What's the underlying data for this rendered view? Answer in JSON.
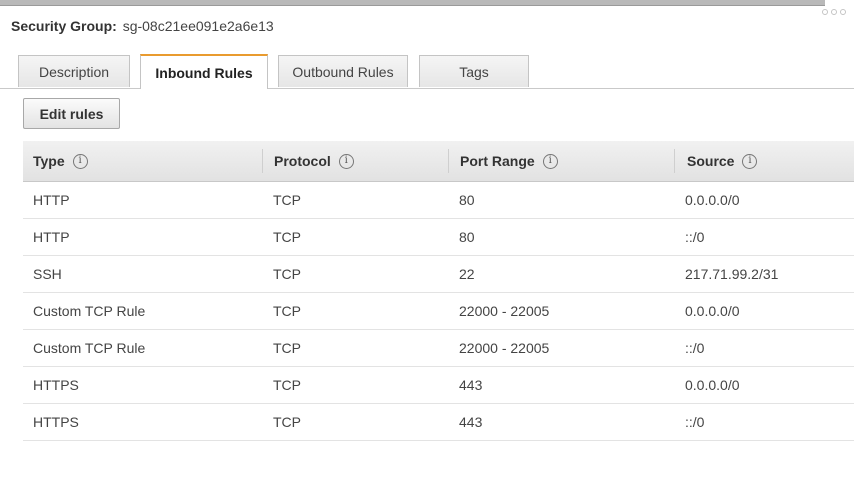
{
  "header": {
    "label": "Security Group:",
    "value": "sg-08c21ee091e2a6e13"
  },
  "tabs": [
    {
      "label": "Description",
      "active": false
    },
    {
      "label": "Inbound Rules",
      "active": true
    },
    {
      "label": "Outbound Rules",
      "active": false
    },
    {
      "label": "Tags",
      "active": false
    }
  ],
  "toolbar": {
    "edit_label": "Edit rules"
  },
  "table": {
    "columns": [
      "Type",
      "Protocol",
      "Port Range",
      "Source"
    ],
    "info_glyph": "i",
    "rows": [
      {
        "type": "HTTP",
        "protocol": "TCP",
        "port": "80",
        "source": "0.0.0.0/0"
      },
      {
        "type": "HTTP",
        "protocol": "TCP",
        "port": "80",
        "source": "::/0"
      },
      {
        "type": "SSH",
        "protocol": "TCP",
        "port": "22",
        "source": "217.71.99.2/31"
      },
      {
        "type": "Custom TCP Rule",
        "protocol": "TCP",
        "port": "22000 - 22005",
        "source": "0.0.0.0/0"
      },
      {
        "type": "Custom TCP Rule",
        "protocol": "TCP",
        "port": "22000 - 22005",
        "source": "::/0"
      },
      {
        "type": "HTTPS",
        "protocol": "TCP",
        "port": "443",
        "source": "0.0.0.0/0"
      },
      {
        "type": "HTTPS",
        "protocol": "TCP",
        "port": "443",
        "source": "::/0"
      }
    ]
  },
  "colors": {
    "active_tab_accent": "#e99b2f",
    "header_bg": "#e6e6e6",
    "text": "#444444"
  },
  "icons": {
    "column_info": "info-icon",
    "resize_handle": "resize-dots-icon"
  }
}
